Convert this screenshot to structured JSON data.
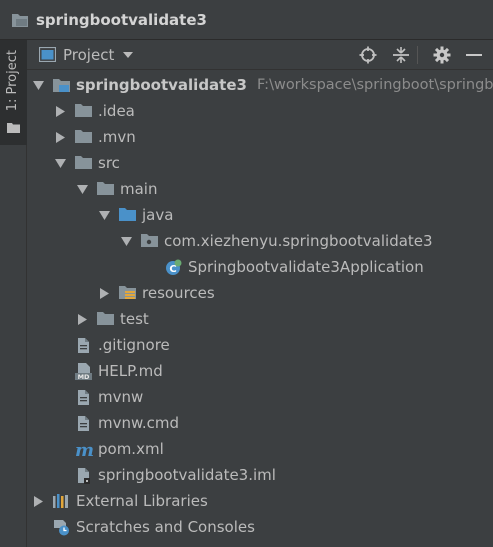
{
  "window": {
    "title": "springbootvalidate3"
  },
  "side_tab": {
    "label": "1: Project"
  },
  "tool_window": {
    "view_label": "Project",
    "toolbar": [
      "locate-icon",
      "collapse-all-icon",
      "settings-gear-icon",
      "hide-icon"
    ]
  },
  "tree": {
    "root": {
      "name": "springbootvalidate3",
      "path": "F:\\workspace\\springboot\\springbo"
    },
    "idea": ".idea",
    "mvn": ".mvn",
    "src": "src",
    "main": "main",
    "java": "java",
    "package": "com.xiezhenyu.springbootvalidate3",
    "app_class": "Springbootvalidate3Application",
    "resources": "resources",
    "test": "test",
    "gitignore": ".gitignore",
    "help": "HELP.md",
    "mvnw": "mvnw",
    "mvnw_cmd": "mvnw.cmd",
    "pom": "pom.xml",
    "iml": "springbootvalidate3.iml",
    "external_libraries": "External Libraries",
    "scratches": "Scratches and Consoles"
  },
  "icon_badges": {
    "md_badge": "MD",
    "maven_m": "m"
  },
  "colors": {
    "background": "#3c3f41",
    "text": "#bbbbbb",
    "folder": "#87939a",
    "source_folder": "#4a91c9",
    "resources_stripes": "#e2a73b",
    "spring_green": "#6aab73"
  }
}
